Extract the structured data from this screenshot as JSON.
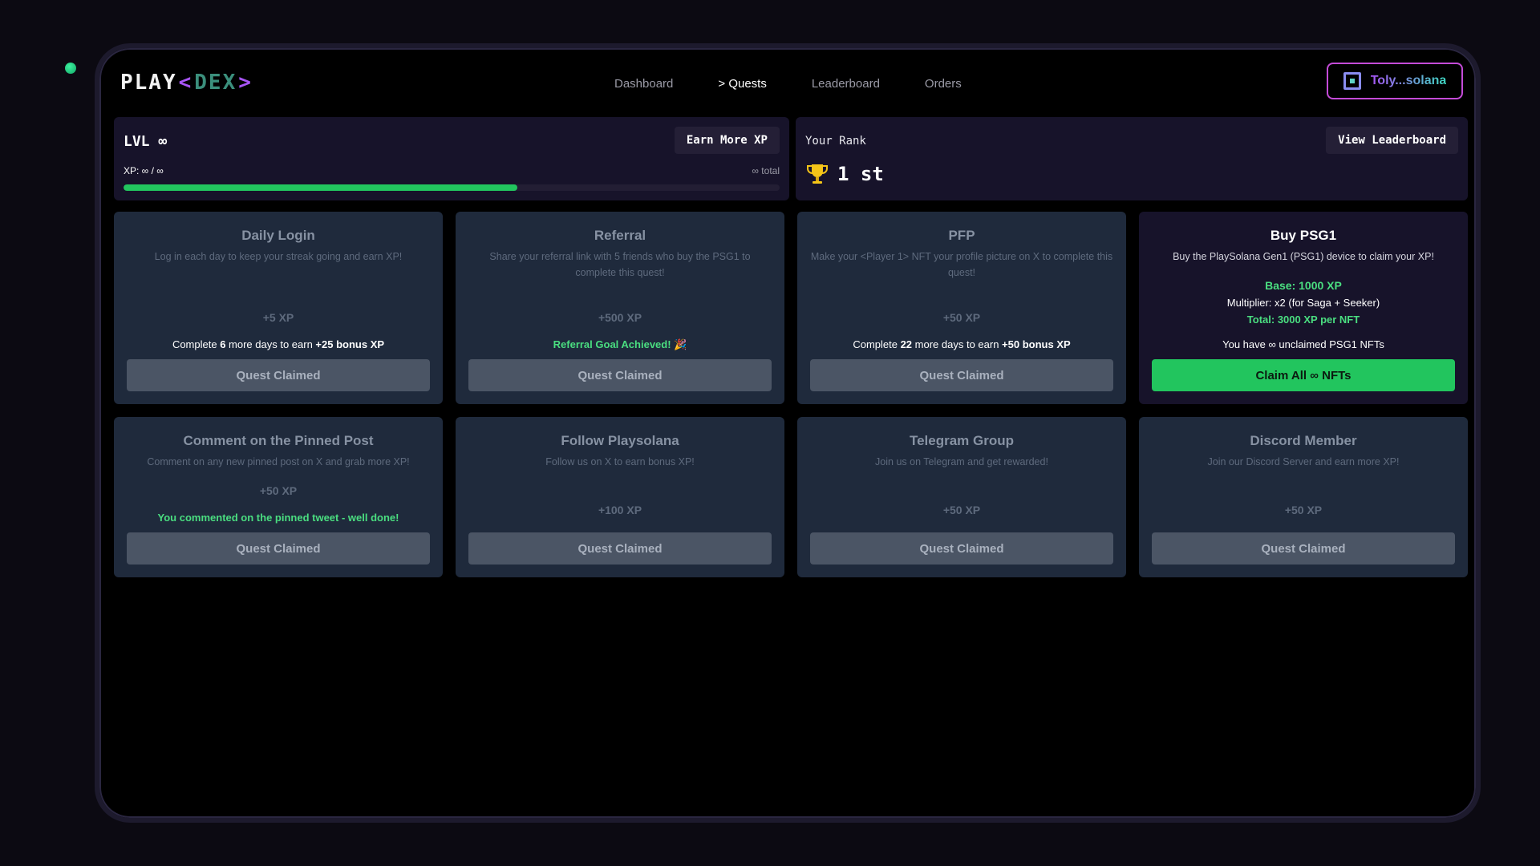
{
  "header": {
    "logo": {
      "play": "PLAY",
      "left_bracket": "<",
      "dex": "DEX",
      "right_bracket": ">"
    },
    "nav": [
      {
        "label": "Dashboard",
        "active": false
      },
      {
        "label": "> Quests",
        "active": true
      },
      {
        "label": "Leaderboard",
        "active": false
      },
      {
        "label": "Orders",
        "active": false
      }
    ],
    "wallet": {
      "label": "Toly...solana",
      "icon": "wallet-square-icon"
    }
  },
  "level_panel": {
    "title": "LVL ∞",
    "button": "Earn More XP",
    "xp_text": "XP: ∞ / ∞",
    "total_text": "∞ total",
    "progress": 0.6
  },
  "rank_panel": {
    "label": "Your Rank",
    "button": "View Leaderboard",
    "rank": "1 st",
    "icon": "trophy-icon"
  },
  "quests": [
    {
      "title": "Daily Login",
      "desc": "Log in each day to keep your streak going and earn XP!",
      "xp": "+5 XP",
      "note_pre": "Complete ",
      "note_num": "6",
      "note_mid": " more days to earn ",
      "note_bonus": "+25 bonus XP",
      "button": "Quest Claimed"
    },
    {
      "title": "Referral",
      "desc": "Share your referral link with 5 friends who buy the PSG1 to complete this quest!",
      "xp": "+500 XP",
      "note": "Referral Goal Achieved! 🎉",
      "button": "Quest Claimed"
    },
    {
      "title": "PFP",
      "desc": "Make your <Player 1> NFT your profile picture on X to complete this quest!",
      "xp": "+50 XP",
      "note_pre": "Complete ",
      "note_num": "22",
      "note_mid": " more days to earn ",
      "note_bonus": "+50 bonus XP",
      "button": "Quest Claimed"
    },
    {
      "title": "Buy PSG1",
      "desc": "Buy the PlaySolana Gen1 (PSG1) device to claim your XP!",
      "base": "Base: 1000 XP",
      "multiplier": "Multiplier: x2 (for Saga + Seeker)",
      "total": "Total: 3000 XP per NFT",
      "unclaimed": "You have ∞ unclaimed PSG1 NFTs",
      "button": "Claim All ∞ NFTs"
    },
    {
      "title": "Comment on the Pinned Post",
      "desc": "Comment on any new pinned post on X and grab more XP!",
      "xp": "+50 XP",
      "note": "You commented on the pinned tweet - well done!",
      "button": "Quest Claimed"
    },
    {
      "title": "Follow Playsolana",
      "desc": "Follow us on X to earn bonus XP!",
      "xp": "+100 XP",
      "button": "Quest Claimed"
    },
    {
      "title": "Telegram Group",
      "desc": "Join us on Telegram and get rewarded!",
      "xp": "+50 XP",
      "button": "Quest Claimed"
    },
    {
      "title": "Discord Member",
      "desc": "Join our Discord Server and earn more XP!",
      "xp": "+50 XP",
      "button": "Quest Claimed"
    }
  ],
  "colors": {
    "accent_green": "#22c55e",
    "accent_purple": "#a855f7",
    "card_bg": "#1f2a3c",
    "panel_bg": "#17132a"
  }
}
